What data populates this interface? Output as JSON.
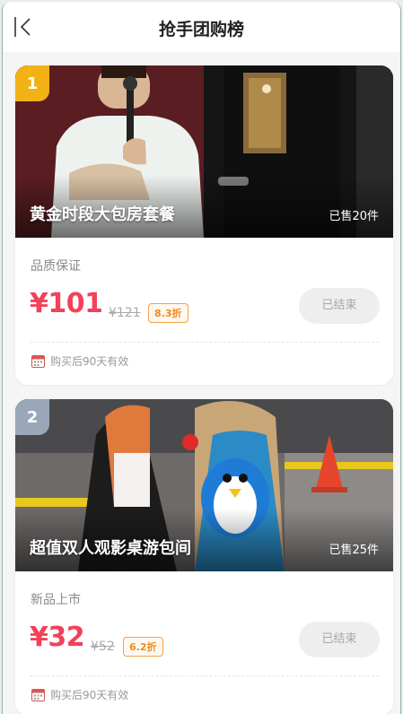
{
  "header": {
    "title": "抢手团购榜"
  },
  "items": [
    {
      "rank": "1",
      "name": "黄金时段大包房套餐",
      "sold": "已售20件",
      "tag": "品质保证",
      "price": "¥101",
      "original_price": "¥121",
      "discount": "8.3折",
      "status": "已结束",
      "validity": "购买后90天有效"
    },
    {
      "rank": "2",
      "name": "超值双人观影桌游包间",
      "sold": "已售25件",
      "tag": "新品上市",
      "price": "¥32",
      "original_price": "¥52",
      "discount": "6.2折",
      "status": "已结束",
      "validity": "购买后90天有效"
    }
  ],
  "colors": {
    "accent": "#f2415a",
    "discount": "#f08a1c",
    "rank1": "#f2b216",
    "rank2": "#9aa7b8"
  },
  "icons": {
    "back": "chevron-left-icon",
    "validity": "calendar-icon"
  }
}
